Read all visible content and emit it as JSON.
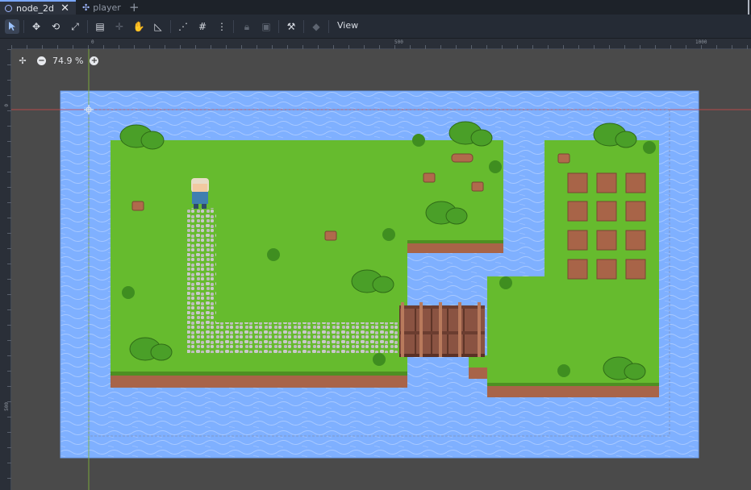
{
  "tabs": [
    {
      "label": "node_2d",
      "active": true
    },
    {
      "label": "player",
      "active": false
    }
  ],
  "toolbar": {
    "tools": [
      "select-tool",
      "move-tool",
      "rotate-tool",
      "scale-tool",
      "list-select-tool",
      "pivot-tool",
      "pan-tool",
      "ruler-tool",
      "smart-snap-toggle",
      "grid-snap-toggle",
      "snap-options-menu",
      "lock-tool",
      "group-tool",
      "skeleton-tool",
      "camera-override-tool"
    ],
    "view_label": "View"
  },
  "rulers": {
    "top_labels": [
      "0",
      "500",
      "1000"
    ],
    "left_labels": [
      "0",
      "500"
    ]
  },
  "viewport": {
    "zoom_label": "74.9 %"
  },
  "colors": {
    "water": "#7fb0ff",
    "grass": "#66bb2e",
    "dirt": "#a86448",
    "bridge": "#8a5342",
    "path": "#c9c9c9",
    "accent": "#7aa7ff"
  }
}
